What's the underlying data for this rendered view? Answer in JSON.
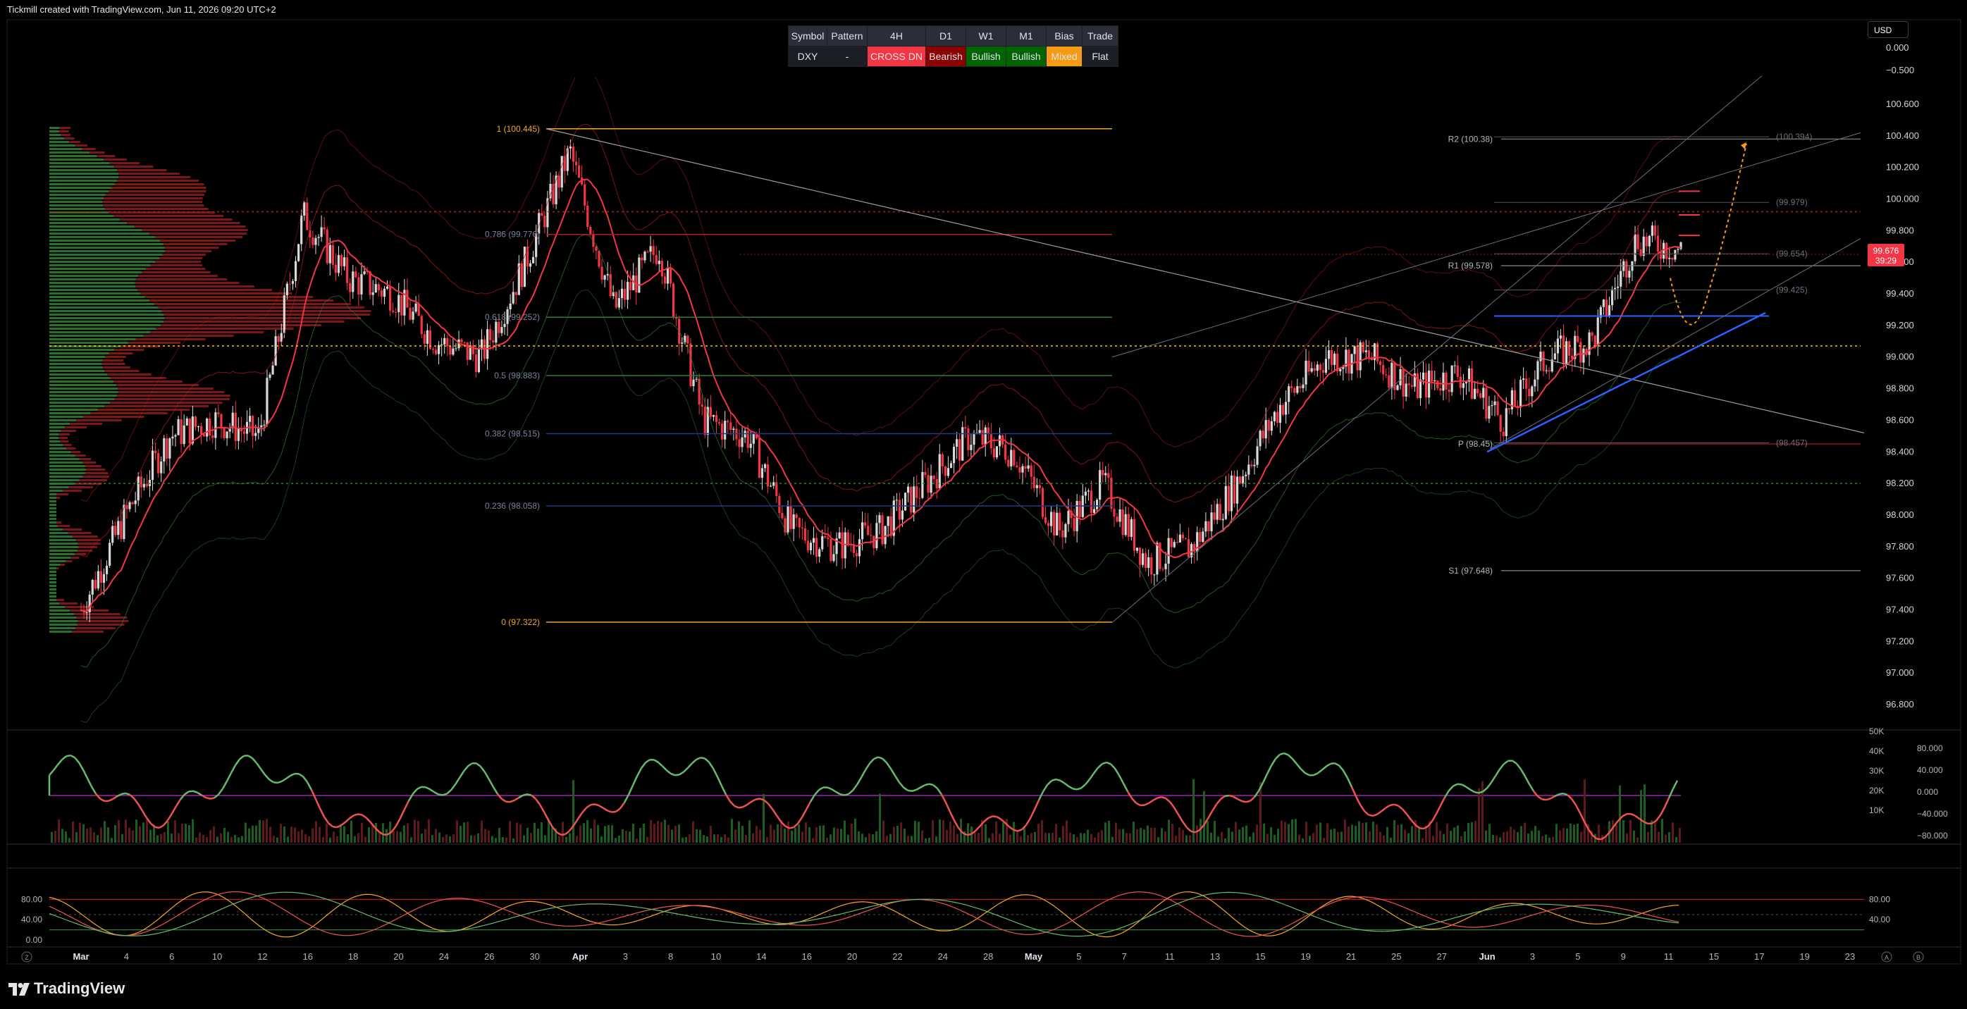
{
  "header": {
    "caption": "Tickmill created with TradingView.com, Jun 11, 2026 09:20 UTC+2"
  },
  "brand": {
    "name": "TradingView"
  },
  "currency_select": {
    "value": "USD"
  },
  "signal_table": {
    "headers": [
      "Symbol",
      "Pattern",
      "4H",
      "D1",
      "W1",
      "M1",
      "Bias",
      "Trade"
    ],
    "values": [
      "DXY",
      "-",
      "CROSS DN",
      "Bearish",
      "Bullish",
      "Bullish",
      "Mixed",
      "Flat"
    ],
    "value_colors": [
      "#1b1e26",
      "#1b1e26",
      "#f23645",
      "#8b0000",
      "#006400",
      "#006400",
      "#f59c12",
      "#1b1e26"
    ]
  },
  "chart_data": [
    {
      "type": "line",
      "name": "price",
      "symbol": "DXY",
      "timeframe": "4H",
      "ylim": [
        96.6,
        100.7
      ],
      "y_ticks": [
        "100.600",
        "100.400",
        "100.200",
        "100.000",
        "99.800",
        "99.600",
        "99.400",
        "99.200",
        "99.000",
        "98.800",
        "98.600",
        "98.400",
        "98.200",
        "98.000",
        "97.800",
        "97.600",
        "97.400",
        "97.200",
        "97.000",
        "96.800"
      ],
      "right_axis_top_ticks": [
        "0.000",
        "−0.500"
      ],
      "x_ticks": [
        "Mar",
        "4",
        "6",
        "10",
        "12",
        "16",
        "18",
        "20",
        "24",
        "26",
        "30",
        "Apr",
        "3",
        "8",
        "10",
        "14",
        "16",
        "20",
        "22",
        "24",
        "28",
        "May",
        "5",
        "7",
        "11",
        "13",
        "15",
        "19",
        "21",
        "25",
        "27",
        "Jun",
        "3",
        "5",
        "9",
        "11",
        "15",
        "17",
        "19",
        "23"
      ],
      "last_price": "99.676",
      "countdown": "39:29",
      "close_path": [
        [
          "Mar",
          97.4
        ],
        [
          "4",
          98.0
        ],
        [
          "6",
          98.5
        ],
        [
          "10",
          98.6
        ],
        [
          "12",
          98.5
        ],
        [
          "16",
          99.9
        ],
        [
          "18",
          99.5
        ],
        [
          "20",
          99.4
        ],
        [
          "24",
          99.1
        ],
        [
          "26",
          99.0
        ],
        [
          "30",
          99.6
        ],
        [
          "Mar 31",
          100.3
        ],
        [
          "Apr",
          99.3
        ],
        [
          "3",
          99.7
        ],
        [
          "8",
          98.6
        ],
        [
          "10",
          98.5
        ],
        [
          "14",
          97.9
        ],
        [
          "16",
          97.8
        ],
        [
          "20",
          97.9
        ],
        [
          "22",
          98.2
        ],
        [
          "24",
          98.5
        ],
        [
          "28",
          98.4
        ],
        [
          "May",
          97.9
        ],
        [
          "5",
          98.2
        ],
        [
          "7",
          97.7
        ],
        [
          "11",
          97.8
        ],
        [
          "13",
          98.2
        ],
        [
          "15",
          98.7
        ],
        [
          "19",
          99.0
        ],
        [
          "21",
          99.0
        ],
        [
          "25",
          98.8
        ],
        [
          "27",
          98.9
        ],
        [
          "Jun",
          98.6
        ],
        [
          "3",
          99.0
        ],
        [
          "5",
          99.1
        ],
        [
          "9",
          99.75
        ],
        [
          "11",
          99.68
        ]
      ],
      "fibonacci": [
        {
          "label": "1 (100.445)",
          "value": 100.445
        },
        {
          "label": "0.786 (99.776)",
          "value": 99.776
        },
        {
          "label": "0.618 (99.252)",
          "value": 99.252
        },
        {
          "label": "0.5 (98.883)",
          "value": 98.883
        },
        {
          "label": "0.382 (98.515)",
          "value": 98.515
        },
        {
          "label": "0.236 (98.058)",
          "value": 98.058
        },
        {
          "label": "0 (97.322)",
          "value": 97.322
        }
      ],
      "pivots": [
        {
          "label": "R2 (100.38)",
          "value": 100.38
        },
        {
          "label": "R1 (99.578)",
          "value": 99.578
        },
        {
          "label": "P (98.45)",
          "value": 98.45
        },
        {
          "label": "S1 (97.648)",
          "value": 97.648
        }
      ],
      "right_levels": [
        {
          "label": "(100.394)",
          "value": 100.394
        },
        {
          "label": "(99.979)",
          "value": 99.979
        },
        {
          "label": "(99.654)",
          "value": 99.654
        },
        {
          "label": "(99.425)",
          "value": 99.425
        },
        {
          "label": "(98.457)",
          "value": 98.457
        }
      ],
      "colors": {
        "up": "#26a69a",
        "down": "#ef5350",
        "fib": "#f5a623",
        "trend": "#2962ff",
        "last_price": "#f23645"
      }
    },
    {
      "type": "line",
      "name": "oscillator-volume",
      "left_ticks": [
        "50K",
        "40K",
        "30K",
        "20K",
        "10K"
      ],
      "right_ticks": [
        "80.000",
        "40.000",
        "0.000",
        "−40.000",
        "−80.000"
      ]
    },
    {
      "type": "line",
      "name": "stochastic",
      "ylim": [
        0,
        100
      ],
      "y_ticks": [
        "80.00",
        "40.00",
        "0.00"
      ],
      "right_ticks": [
        "80.00",
        "40.00"
      ]
    }
  ]
}
